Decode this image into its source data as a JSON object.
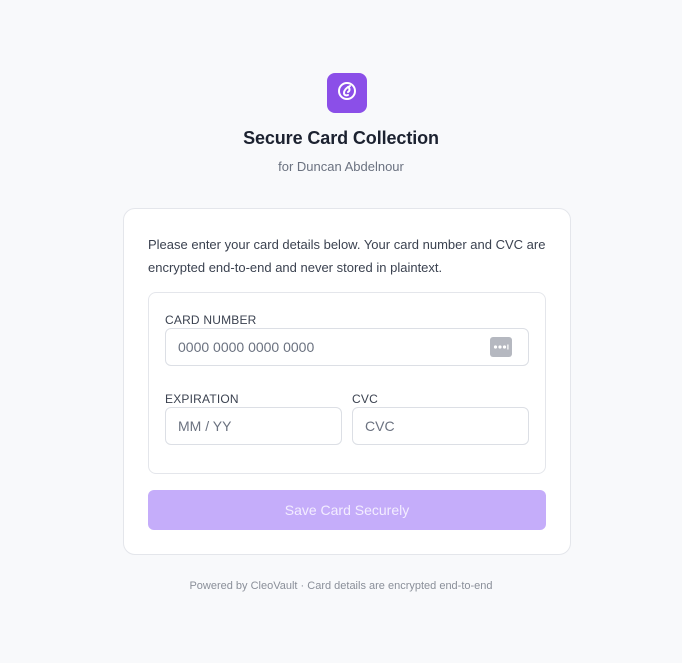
{
  "header": {
    "logo_icon": "link-swirl-icon",
    "title": "Secure Card Collection",
    "subtitle": "for Duncan Abdelnour"
  },
  "card": {
    "intro": "Please enter your card details below. Your card number and CVC are encrypted end-to-end and never stored in plaintext.",
    "fields": {
      "card_number": {
        "label": "CARD NUMBER",
        "placeholder": "0000 0000 0000 0000",
        "icon": "credit-card-dots-icon"
      },
      "expiration": {
        "label": "EXPIRATION",
        "placeholder": "MM / YY"
      },
      "cvc": {
        "label": "CVC",
        "placeholder": "CVC"
      }
    },
    "save_label": "Save Card Securely"
  },
  "footer": {
    "text": "Powered by CleoVault · Card details are encrypted end-to-end"
  },
  "colors": {
    "brand": "#8b4fe8",
    "button_disabled": "#c5adfa",
    "background": "#f8f9fb"
  }
}
